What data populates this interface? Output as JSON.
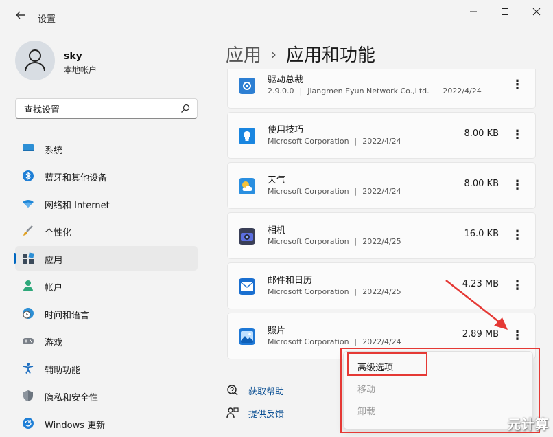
{
  "window": {
    "title": "设置",
    "controls": {
      "minimize": "—",
      "maximize": "☐",
      "close": "✕"
    }
  },
  "profile": {
    "name": "sky",
    "account_type": "本地帐户"
  },
  "search": {
    "placeholder": "查找设置",
    "value": "查找设置"
  },
  "nav": [
    {
      "label": "系统",
      "icon": "monitor-icon"
    },
    {
      "label": "蓝牙和其他设备",
      "icon": "bluetooth-icon"
    },
    {
      "label": "网络和 Internet",
      "icon": "wifi-icon"
    },
    {
      "label": "个性化",
      "icon": "brush-icon"
    },
    {
      "label": "应用",
      "icon": "apps-icon",
      "active": true
    },
    {
      "label": "帐户",
      "icon": "person-icon"
    },
    {
      "label": "时间和语言",
      "icon": "clock-globe-icon"
    },
    {
      "label": "游戏",
      "icon": "gamepad-icon"
    },
    {
      "label": "辅助功能",
      "icon": "accessibility-icon"
    },
    {
      "label": "隐私和安全性",
      "icon": "shield-icon"
    },
    {
      "label": "Windows 更新",
      "icon": "update-icon"
    }
  ],
  "header": {
    "parent": "应用",
    "separator": "›",
    "current": "应用和功能"
  },
  "apps": [
    {
      "name": "驱动总裁",
      "publisher": "2.9.0.0",
      "publisher2": "Jiangmen Eyun Network Co.,Ltd.",
      "date": "2022/4/24",
      "size": "",
      "icon": "gear-blue-icon"
    },
    {
      "name": "使用技巧",
      "publisher": "Microsoft Corporation",
      "date": "2022/4/24",
      "size": "8.00 KB",
      "icon": "lightbulb-icon"
    },
    {
      "name": "天气",
      "publisher": "Microsoft Corporation",
      "date": "2022/4/24",
      "size": "8.00 KB",
      "icon": "weather-icon"
    },
    {
      "name": "相机",
      "publisher": "Microsoft Corporation",
      "date": "2022/4/25",
      "size": "16.0 KB",
      "icon": "camera-icon"
    },
    {
      "name": "邮件和日历",
      "publisher": "Microsoft Corporation",
      "date": "2022/4/25",
      "size": "4.23 MB",
      "icon": "mail-icon"
    },
    {
      "name": "照片",
      "publisher": "Microsoft Corporation",
      "date": "2022/4/24",
      "size": "2.89 MB",
      "icon": "photos-icon"
    }
  ],
  "more_glyph": "⋮",
  "separator_glyph": "|",
  "footer": {
    "help": "获取帮助",
    "feedback": "提供反馈"
  },
  "context_menu": {
    "advanced": "高级选项",
    "move": "移动",
    "uninstall": "卸载"
  },
  "watermark": "元计算",
  "colors": {
    "accent": "#0067c0",
    "annotation": "#e53935"
  }
}
